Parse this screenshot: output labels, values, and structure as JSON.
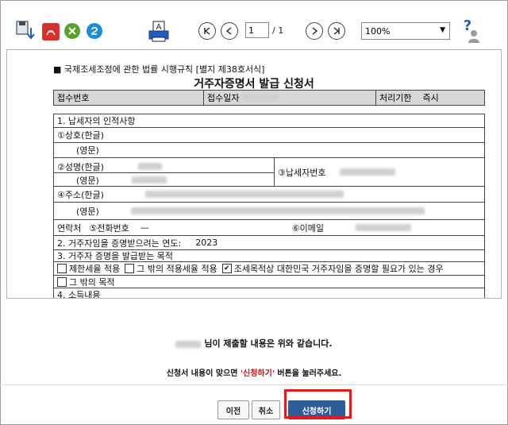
{
  "toolbar": {
    "icons": [
      "save-icon",
      "pdf-icon",
      "excel-icon",
      "hwp-icon",
      "print-icon",
      "help-icon"
    ],
    "print_letter": "A",
    "page_value": "1",
    "page_total": "/ 1",
    "zoom": "100%"
  },
  "form": {
    "regulation": "■ 국제조세조정에 관한 법률 시행규칙 [별지 제38호서식]",
    "title": "거주자증명서 발급 신청서",
    "receipt": {
      "receipt_no_label": "접수번호",
      "receipt_date_label": "접수일자",
      "deadline_label": "처리기한",
      "deadline_value": "즉시"
    },
    "section1": "1. 납세자의 인적사항",
    "name_kor_label": "①상호(한글)",
    "name_eng_label": "(영문)",
    "person_kor_label": "②성명(한글)",
    "person_eng_label": "(영문)",
    "taxpayer_no_label": "③납세자번호",
    "address_kor_label": "④주소(한글)",
    "address_eng_label": "(영문)",
    "contact_label": "연락처",
    "phone_label": "⑤전화번호",
    "phone_value": "—",
    "email_label": "⑥이메일",
    "section2": "2. 거주자임을 증명받으려는 연도:",
    "year_value": "2023",
    "section3": "3. 거주자 증명을 발급받는 목적",
    "purposes": [
      {
        "label": "제한세율 적용",
        "checked": false
      },
      {
        "label": "그 밖의 적용세율 적용",
        "checked": false
      },
      {
        "label": "조세목적상 대한민국 거주자임을 증명할 필요가 있는 경우",
        "checked": true
      },
      {
        "label": "그 밖의 목적",
        "checked": false
      }
    ],
    "section4": "4. 소득내용"
  },
  "footer": {
    "submit_message": "님이 제출할 내용은 위와 같습니다.",
    "instruction_before": "신청서 내용이 맞으면 ",
    "instruction_highlight": "'신청하기'",
    "instruction_after": " 버튼을 눌러주세요.",
    "prev_label": "이전",
    "cancel_label": "취소",
    "apply_label": "신청하기"
  }
}
